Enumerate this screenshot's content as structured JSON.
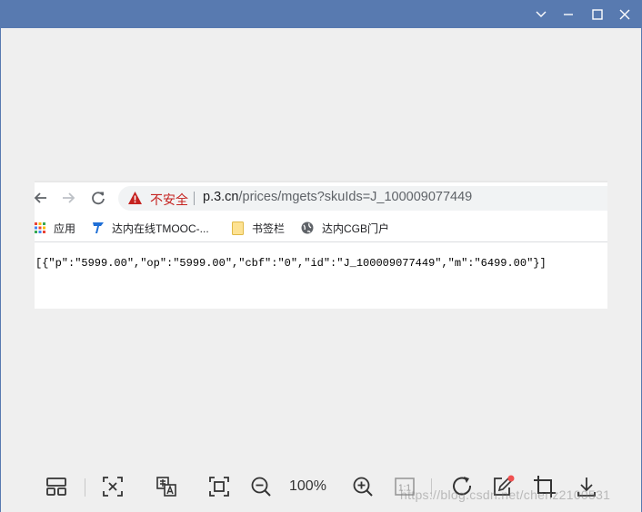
{
  "browser": {
    "security_label": "不安全",
    "url_host": "p.3.cn",
    "url_path": "/prices/mgets?skuIds=J_100009077449"
  },
  "bookmarks": [
    {
      "label": "应用",
      "icon": "apps-grid-icon"
    },
    {
      "label": "达内在线TMOOC-...",
      "icon": "tmooc-logo-icon"
    },
    {
      "label": "书签栏",
      "icon": "folder-icon"
    },
    {
      "label": "达内CGB门户",
      "icon": "globe-icon"
    }
  ],
  "page_body": {
    "json_text": "[{\"p\":\"5999.00\",\"op\":\"5999.00\",\"cbf\":\"0\",\"id\":\"J_100009077449\",\"m\":\"6499.00\"}]"
  },
  "viewer": {
    "zoom_level": "100%",
    "actual_size_label": "1:1",
    "watermark": "https://blog.csdn.net/chenz2100531"
  },
  "colors": {
    "titlebar": "#587ab0",
    "insecure_red": "#c5221f",
    "background": "#efefef"
  }
}
